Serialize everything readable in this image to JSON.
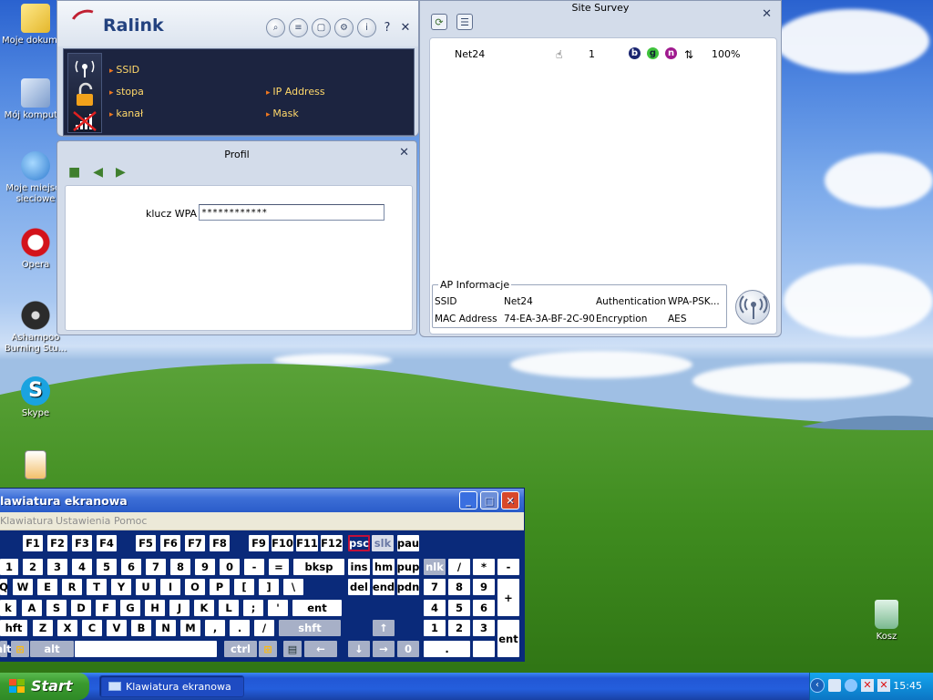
{
  "desktop": {
    "icons": [
      {
        "label": "Moje dokumenty",
        "icon": "my-documents-icon"
      },
      {
        "label": "Mój komputer",
        "icon": "my-computer-icon"
      },
      {
        "label": "Moje miejsca sieciowe",
        "icon": "network-places-icon"
      },
      {
        "label": "Opera",
        "icon": "opera-icon"
      },
      {
        "label": "Ashampoo Burning Stu...",
        "icon": "ashampoo-icon"
      },
      {
        "label": "Skype",
        "icon": "skype-icon"
      },
      {
        "label": "",
        "icon": "file-icon"
      },
      {
        "label": "Kosz",
        "icon": "recycle-bin-icon"
      }
    ]
  },
  "ralink": {
    "brand": "Ralink",
    "toolbar": {
      "help": "?",
      "close": "✕"
    },
    "info": {
      "ssid_label": "SSID",
      "stopa_label": "stopa",
      "kanal_label": "kanał",
      "ip_label": "IP Address",
      "mask_label": "Mask"
    }
  },
  "profil": {
    "title": "Profil",
    "close": "✕",
    "wpa_label": "klucz WPA",
    "wpa_value": "************"
  },
  "survey": {
    "title": "Site Survey",
    "close": "✕",
    "networks": [
      {
        "ssid": "Net24",
        "channel": "1",
        "modes": [
          "b",
          "g",
          "n"
        ],
        "signal": "100%"
      }
    ],
    "ap_info": {
      "legend": "AP Informacje",
      "ssid_label": "SSID",
      "ssid_value": "Net24",
      "auth_label": "Authentication",
      "auth_value": "WPA-PSK...",
      "mac_label": "MAC Address",
      "mac_value": "74-EA-3A-BF-2C-90",
      "enc_label": "Encryption",
      "enc_value": "AES"
    }
  },
  "osk": {
    "title": "lawiatura ekranowa",
    "menu": [
      "Klawiatura",
      "Ustawienia",
      "Pomoc"
    ],
    "keys": {
      "row0": [
        "F1",
        "F2",
        "F3",
        "F4",
        "F5",
        "F6",
        "F7",
        "F8",
        "F9",
        "F10",
        "F11",
        "F12",
        "psc",
        "slk",
        "pau"
      ],
      "row1": [
        "1",
        "2",
        "3",
        "4",
        "5",
        "6",
        "7",
        "8",
        "9",
        "0",
        "-",
        "=",
        "bksp",
        "ins",
        "hm",
        "pup",
        "nlk",
        "/",
        "*",
        "-"
      ],
      "row2": [
        "Q",
        "W",
        "E",
        "R",
        "T",
        "Y",
        "U",
        "I",
        "O",
        "P",
        "[",
        "]",
        "\\",
        "del",
        "end",
        "pdn",
        "7",
        "8",
        "9",
        "+"
      ],
      "row3": [
        "k",
        "A",
        "S",
        "D",
        "F",
        "G",
        "H",
        "J",
        "K",
        "L",
        ";",
        "'",
        "ent",
        "4",
        "5",
        "6"
      ],
      "row4": [
        "hft",
        "Z",
        "X",
        "C",
        "V",
        "B",
        "N",
        "M",
        ",",
        ".",
        "/",
        "shft",
        "↑",
        "1",
        "2",
        "3",
        "ent"
      ],
      "row5": [
        "alt",
        "alt",
        "ctrl",
        "←",
        "↓",
        "→",
        "0",
        "."
      ]
    }
  },
  "taskbar": {
    "start": "Start",
    "task": "Klawiatura ekranowa",
    "clock": "15:45"
  }
}
